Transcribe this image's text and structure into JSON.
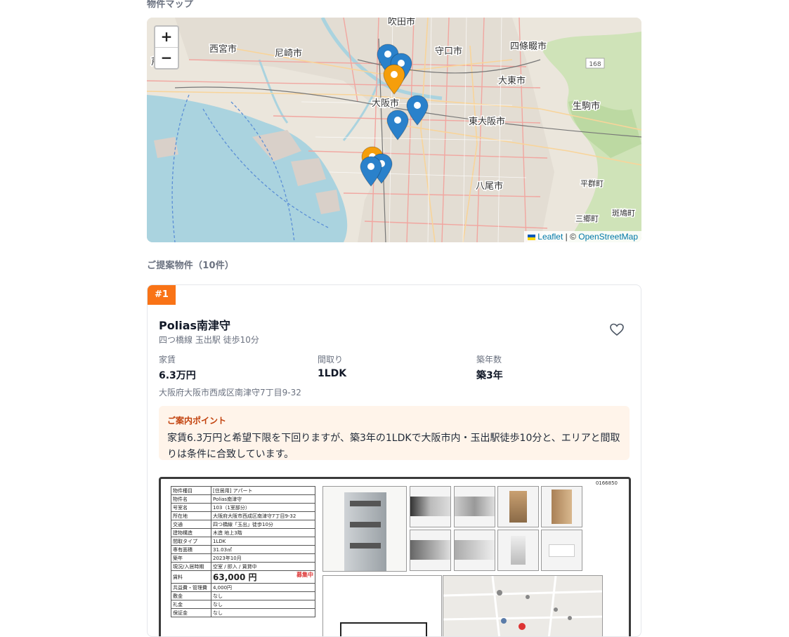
{
  "map_section": {
    "title": "物件マップ",
    "zoom_in": "+",
    "zoom_out": "−",
    "attribution_leaflet": "Leaflet",
    "attribution_sep": " | © ",
    "attribution_osm": "OpenStreetMap",
    "city_labels": [
      "吹田市",
      "西宮市",
      "尼崎市",
      "守口市",
      "四條畷市",
      "大東市",
      "生駒市",
      "大阪市",
      "東大阪市",
      "平群町",
      "八尾市",
      "三郷町",
      "斑鳩町",
      "芦屋市"
    ],
    "road_numbers": [
      "168"
    ]
  },
  "list_section": {
    "title": "ご提案物件（10件）"
  },
  "property": {
    "rank": "#1",
    "name": "Polias南津守",
    "station": "四つ橋線 玉出駅 徒歩10分",
    "rent_label": "家賃",
    "rent_value": "6.3万円",
    "layout_label": "間取り",
    "layout_value": "1LDK",
    "age_label": "築年数",
    "age_value": "築3年",
    "address": "大阪府大阪市西成区南津守7丁目9-32",
    "point_title": "ご案内ポイント",
    "point_text": "家賃6.3万円と希望下限を下回りますが、築3年の1LDKで大阪市内・玉出駅徒歩10分と、エリアと間取りは条件に合致しています。"
  },
  "flyer": {
    "ref": "0166850",
    "rows": [
      [
        "物件種目",
        "[住居用] アパート"
      ],
      [
        "物件名",
        "Polias南津守"
      ],
      [
        "号室名",
        "103（1室部分）"
      ],
      [
        "所在地",
        "大阪府大阪市西成区南津守7丁目9-32"
      ],
      [
        "交通",
        "四つ橋線「玉出」徒歩10分"
      ],
      [
        "建物構造",
        "木造 地上3階"
      ],
      [
        "間取タイプ",
        "1LDK"
      ],
      [
        "専有面積",
        "31.03㎡"
      ],
      [
        "築年",
        "2023年10月"
      ],
      [
        "現況/入居時期",
        "空室 / 即入 / 賃貸中"
      ],
      [
        "賃料",
        "63,000 円"
      ],
      [
        "共益費・管理費",
        "4,000円"
      ],
      [
        "敷金",
        "なし"
      ],
      [
        "礼金",
        "なし"
      ],
      [
        "保証金",
        "なし"
      ]
    ],
    "rent_note": "募集中"
  },
  "colors": {
    "accent": "#f97316",
    "marker_blue": "#2a81cb",
    "marker_orange": "#f59e0b"
  }
}
